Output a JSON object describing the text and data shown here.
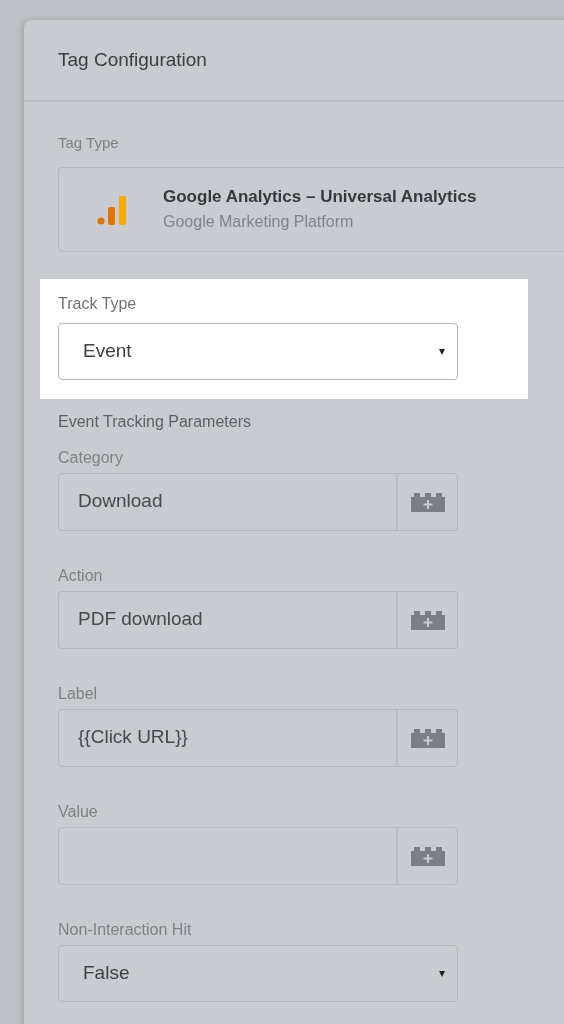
{
  "panel": {
    "title": "Tag Configuration"
  },
  "tag_type": {
    "label": "Tag Type",
    "name": "Google Analytics – Universal Analytics",
    "vendor": "Google Marketing Platform"
  },
  "track_type": {
    "label": "Track Type",
    "value": "Event",
    "arrow": "▾",
    "highlighted": true
  },
  "section": {
    "title": "Event Tracking Parameters"
  },
  "fields": [
    {
      "kind": "variable",
      "label": "Category",
      "value": "Download"
    },
    {
      "kind": "variable",
      "label": "Action",
      "value": "PDF download"
    },
    {
      "kind": "variable",
      "label": "Label",
      "value": "{{Click URL}}"
    },
    {
      "kind": "variable",
      "label": "Value"
    },
    {
      "kind": "select",
      "label": "Non-Interaction Hit",
      "value": "False",
      "arrow": "▾"
    }
  ]
}
